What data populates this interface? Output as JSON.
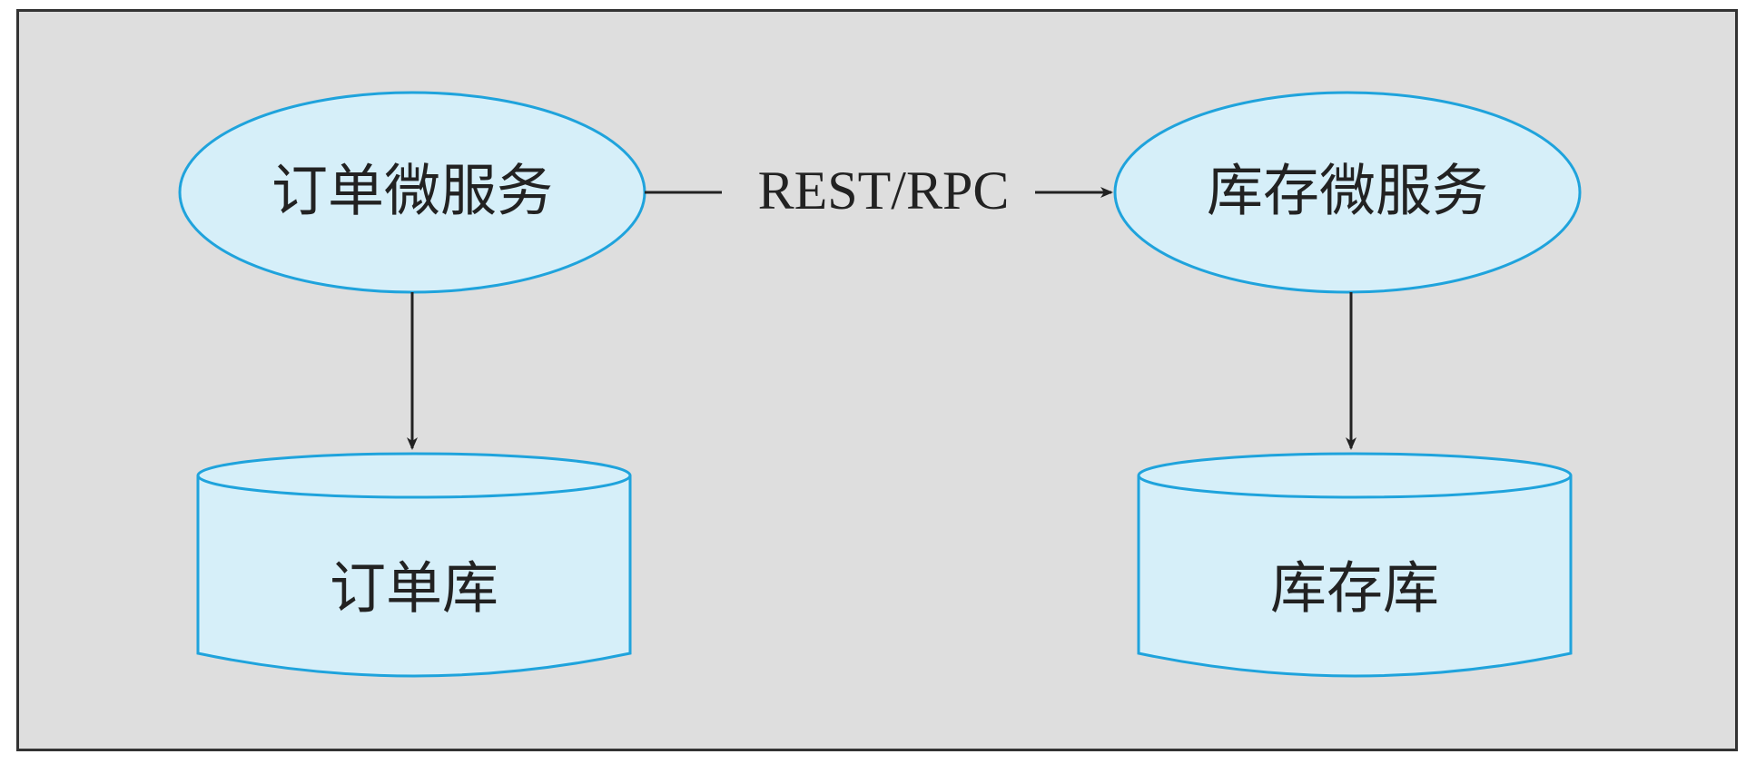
{
  "colors": {
    "background": "#dedede",
    "frame_border": "#333333",
    "node_fill": "#d6eff9",
    "node_stroke": "#1fa3dc",
    "arrow": "#222222",
    "text": "#222222"
  },
  "nodes": {
    "order_service": {
      "label": "订单微服务",
      "shape": "ellipse"
    },
    "inventory_service": {
      "label": "库存微服务",
      "shape": "ellipse"
    },
    "order_db": {
      "label": "订单库",
      "shape": "database-cylinder"
    },
    "inventory_db": {
      "label": "库存库",
      "shape": "database-cylinder"
    }
  },
  "edges": {
    "service_call": {
      "from": "order_service",
      "to": "inventory_service",
      "label": "REST/RPC"
    },
    "order_storage": {
      "from": "order_service",
      "to": "order_db",
      "label": ""
    },
    "inventory_storage": {
      "from": "inventory_service",
      "to": "inventory_db",
      "label": ""
    }
  }
}
